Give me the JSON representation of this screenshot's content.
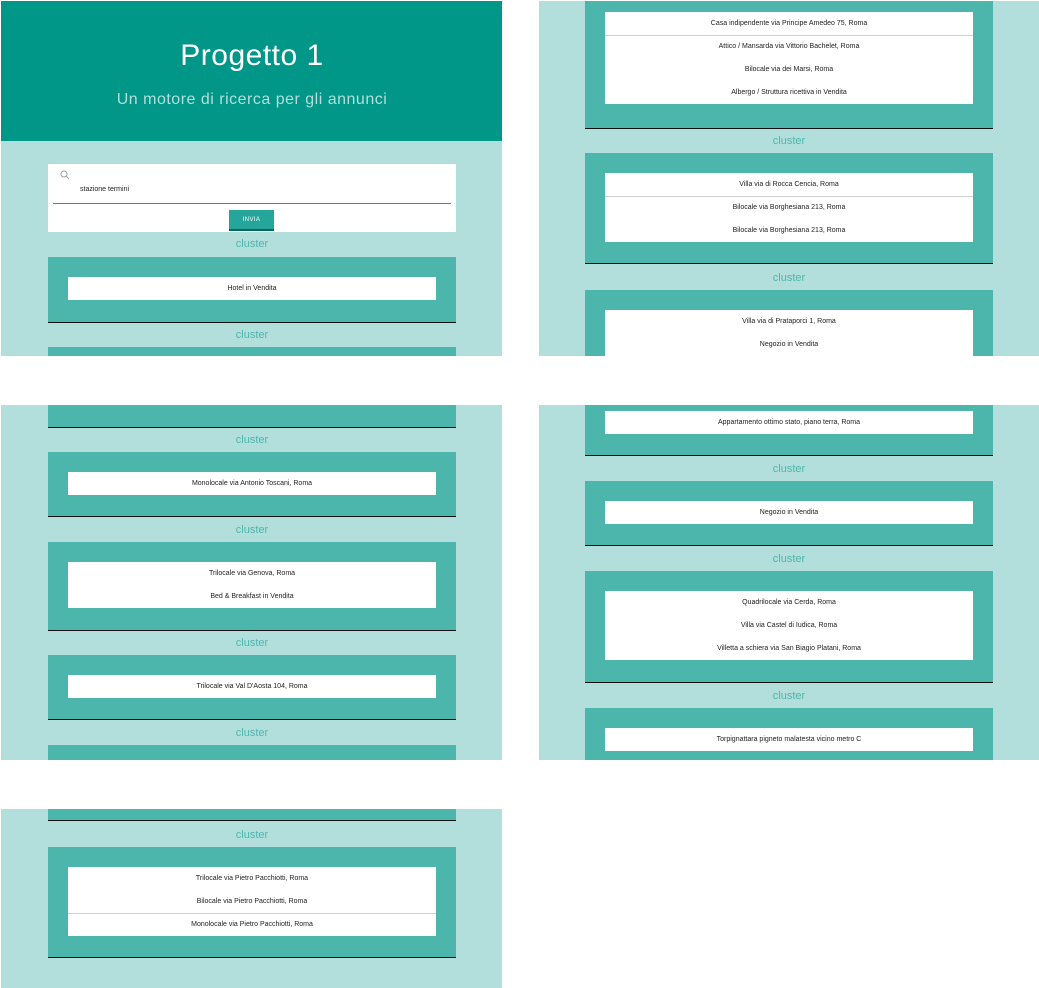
{
  "header": {
    "title": "Progetto 1",
    "subtitle": "Un motore di ricerca per gli annunci"
  },
  "search": {
    "value": "stazione termini",
    "button_label": "INVIA"
  },
  "cluster_label": "cluster",
  "results": {
    "panel1": {
      "c1": [
        "Hotel in Vendita"
      ]
    },
    "panel2": {
      "c1": [
        "Casa indipendente via Principe Amedeo 75, Roma",
        "Attico / Mansarda via Vittorio Bachelet, Roma",
        "Bilocale via dei Marsi, Roma",
        "Albergo / Struttura ricettiva in Vendita"
      ],
      "c2": [
        "Villa via di Rocca Cencia, Roma",
        "Bilocale via Borghesiana 213, Roma",
        "Bilocale via Borghesiana 213, Roma"
      ],
      "c3": [
        "Villa via di Prataporci 1, Roma",
        "Negozio in Vendita"
      ]
    },
    "panel3": {
      "c1": [
        "Monolocale via Antonio Toscani, Roma"
      ],
      "c2": [
        "Trilocale via Genova, Roma",
        "Bed & Breakfast in Vendita"
      ],
      "c3": [
        "Trilocale via Val D'Aosta 104, Roma"
      ]
    },
    "panel4": {
      "c0": [
        "Appartamento ottimo stato, piano terra, Roma"
      ],
      "c1": [
        "Negozio in Vendita"
      ],
      "c2": [
        "Quadrilocale via Cerda, Roma",
        "Villa via Castel di Iudica, Roma",
        "Villetta a schiera via San Biagio Platani, Roma"
      ],
      "c3": [
        "Torpignattara pigneto malatesta vicino metro C"
      ]
    },
    "panel5": {
      "c1": [
        "Trilocale via Pietro Pacchiotti, Roma",
        "Bilocale via Pietro Pacchiotti, Roma",
        "Monolocale via Pietro Pacchiotti, Roma"
      ]
    }
  }
}
